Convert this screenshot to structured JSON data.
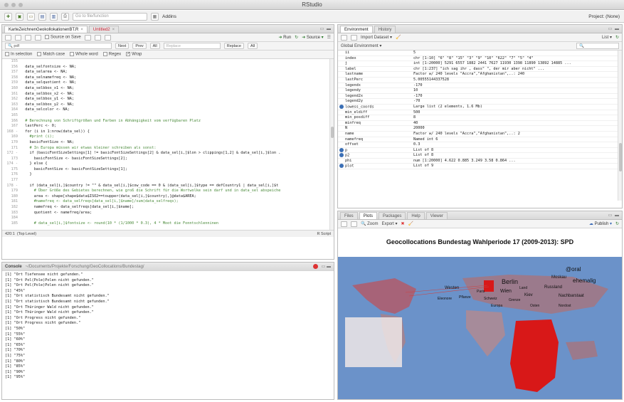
{
  "window": {
    "title": "RStudio"
  },
  "toolbar": {
    "goto_placeholder": "Go to file/function",
    "addins": "Addins",
    "project": "Project: (None)"
  },
  "source": {
    "tabs": [
      "KarteZeichnenGeokollokationenBT.R",
      "Untitled2"
    ],
    "source_on_save": "Source on Save",
    "run": "Run",
    "source_btn": "Source",
    "find_value": "pdf",
    "find_buttons": [
      "Next",
      "Prev",
      "All"
    ],
    "replace_placeholder": "Replace",
    "replace_buttons": [
      "Replace",
      "All"
    ],
    "options": [
      "In selection",
      "Match case",
      "Whole word",
      "Regex",
      "Wrap"
    ],
    "status_pos": "420:1",
    "status_scope": "(Top Level)",
    "status_type": "R Script"
  },
  "code_lines": [
    {
      "n": "155",
      "t": ""
    },
    {
      "n": "156",
      "t": "  data_selfontsize <- NA;"
    },
    {
      "n": "157",
      "t": "  data_selarea <- NA;"
    },
    {
      "n": "158",
      "t": "  data_selnamefreq <- NA;"
    },
    {
      "n": "159",
      "t": "  data_selquotient <- NA;"
    },
    {
      "n": "160",
      "t": "  data_selbbox_x1 <- NA;"
    },
    {
      "n": "161",
      "t": "  data_selbbox_x2 <- NA;"
    },
    {
      "n": "162",
      "t": "  data_selbbox_y1 <- NA;"
    },
    {
      "n": "163",
      "t": "  data_selbbox_y2 <- NA;"
    },
    {
      "n": "164",
      "t": "  data_selcolor <- NA;"
    },
    {
      "n": "165",
      "t": ""
    },
    {
      "n": "166",
      "t": "  # Berechnung von Schriftgrößen und Farben in Abhängigkeit vom verfügbaren Platz",
      "c": "c-cm"
    },
    {
      "n": "167",
      "t": "  lastPerc <- 0;"
    },
    {
      "n": "168 -",
      "t": "  for (i in 1:nrow(data_sel)) {"
    },
    {
      "n": "169",
      "t": "    #print (i);",
      "c": "c-cm"
    },
    {
      "n": "170",
      "t": "    basicFontSize <- NA;"
    },
    {
      "n": "171",
      "t": "    # In Europa müssen wir etwas kleiner schreiben als sonst:",
      "c": "c-cm"
    },
    {
      "n": "172 -",
      "t": "    if (basicFontSizeSettings[1] != basicFontSizeSettings[2] & data_sel[i,]$lon > clippings[1,2] & data_sel[i,]$lon ."
    },
    {
      "n": "173",
      "t": "      basicFontSize <- basicFontSizeSettings[2];"
    },
    {
      "n": "174 -",
      "t": "    } else {"
    },
    {
      "n": "175",
      "t": "      basicFontSize <- basicFontSizeSettings[1];"
    },
    {
      "n": "176",
      "t": "    }"
    },
    {
      "n": "177",
      "t": ""
    },
    {
      "n": "178 -",
      "t": "    if (data_sel[i,]$country != \"\" & data_sel[i,]$cow_code == 0 & (data_sel[i,]$type == defCountry1 | data_sel[i,]$t"
    },
    {
      "n": "179",
      "t": "      # Über Größe des Gebietes berechnen, wie groß die Schrift für die Wortwolke sein darf und in data_sel abspeiche",
      "c": "c-cm"
    },
    {
      "n": "180",
      "t": "      area <- shape[shape$data$ISO2==toupper(data_sel[i,]$country),]@data$AREA;"
    },
    {
      "n": "181",
      "t": "      #namefreq <- data_selfreqs[data_sel[i,]$name]/sum(data_selfreqs);",
      "c": "c-cm"
    },
    {
      "n": "182",
      "t": "      namefreq <- data_selfreqs[data_sel[i,]$name];"
    },
    {
      "n": "183",
      "t": "      quotient <- namefreq/area;"
    },
    {
      "n": "184",
      "t": ""
    },
    {
      "n": "185",
      "t": "      # data_sel[i,]$fontsize <- round(10 * (1/1000 * 0.3), 4 * Moot die Fonntschlenninen",
      "c": "c-cm"
    }
  ],
  "console": {
    "title": "Console",
    "path": "~/Documents/Projekte/Forschung/GeoCollocations/Bundestag/",
    "lines": [
      "[1] \"Ort Tiefensee nicht gefunden.\"",
      "[1] \"Ort Pol(Pole)Polen nicht gefunden.\"",
      "[1] \"Ort Pol(Pole)Polen nicht gefunden.\"",
      "[1] \"45%\"",
      "[1] \"Ort statistisch Bundesamt nicht gefunden.\"",
      "[1] \"Ort statistisch Bundesamt nicht gefunden.\"",
      "[1] \"Ort Thüringer Wald nicht gefunden.\"",
      "[1] \"Ort Thüringer Wald nicht gefunden.\"",
      "[1] \"Ort Progress nicht gefunden.\"",
      "[1] \"Ort Progress nicht gefunden.\"",
      "[1] \"50%\"",
      "[1] \"55%\"",
      "[1] \"60%\"",
      "[1] \"65%\"",
      "[1] \"70%\"",
      "[1] \"75%\"",
      "[1] \"80%\"",
      "[1] \"85%\"",
      "[1] \"90%\"",
      "[1] \"95%\""
    ]
  },
  "env": {
    "tabs": [
      "Environment",
      "History"
    ],
    "import": "Import Dataset",
    "list": "List",
    "scope": "Global Environment",
    "rows": [
      {
        "name": "ii",
        "value": "5"
      },
      {
        "name": "index",
        "value": "chr [1:10] \"6\" \"8\" \"15\" \"3\" \"9\" \"10\" \"622\" \"7\" \"5\" \"4\""
      },
      {
        "name": "j",
        "value": "int [1:20000] 5291 6557 1882 2441 7627 11930 1398 11890 13892 14885 ..."
      },
      {
        "name": "label",
        "value": "chr [1:237] \"ich sag ihr , dass\" \", der mir aber nicht\" ..."
      },
      {
        "name": "lastname",
        "value": "Factor w/ 240 levels \"Accra\",\"Afghanistan\",..: 240"
      },
      {
        "name": "lastPerc",
        "value": "5.00555144337528"
      },
      {
        "name": "legendx",
        "value": "-170"
      },
      {
        "name": "legendy",
        "value": "10"
      },
      {
        "name": "legend2x",
        "value": "-170"
      },
      {
        "name": "legend2y",
        "value": "-70"
      },
      {
        "name": "lowess_coords",
        "value": "Large list (2 elements, 1.6 Mb)",
        "dot": true
      },
      {
        "name": "min_eldiff",
        "value": "500"
      },
      {
        "name": "min_posdiff",
        "value": "8"
      },
      {
        "name": "minfreq",
        "value": "40"
      },
      {
        "name": "N",
        "value": "20000"
      },
      {
        "name": "name",
        "value": "Factor w/ 240 levels \"Accra\",\"Afghanistan\",..: 2"
      },
      {
        "name": "namefreq",
        "value": "Named int 6"
      },
      {
        "name": "offset",
        "value": "0.3"
      },
      {
        "name": "p",
        "value": "List of 8",
        "dot": true
      },
      {
        "name": "p2",
        "value": "List of 8",
        "dot": true
      },
      {
        "name": "phi",
        "value": "num [1:20000] 4.622 0.885 3.249 3.58 0.864 ..."
      },
      {
        "name": "plot",
        "value": "List of 9",
        "dot": true
      }
    ]
  },
  "files": {
    "tabs": [
      "Files",
      "Plots",
      "Packages",
      "Help",
      "Viewer"
    ],
    "zoom": "Zoom",
    "export": "Export",
    "publish": "Publish",
    "plot_title": "Geocollocations Bundestag Wahlperiode 17 (2009-2013): SPD",
    "map_labels": [
      "Berlin",
      "Wien",
      "ehemalig",
      "Russland",
      "Kiev",
      "Westen",
      "Moskau",
      "Nachbarstaat",
      "Schweiz",
      "Pflanze",
      "Osten",
      "Grenze",
      "Eleonore",
      "Paris",
      "Europa",
      "Land",
      "Nordost",
      "@oral"
    ]
  }
}
